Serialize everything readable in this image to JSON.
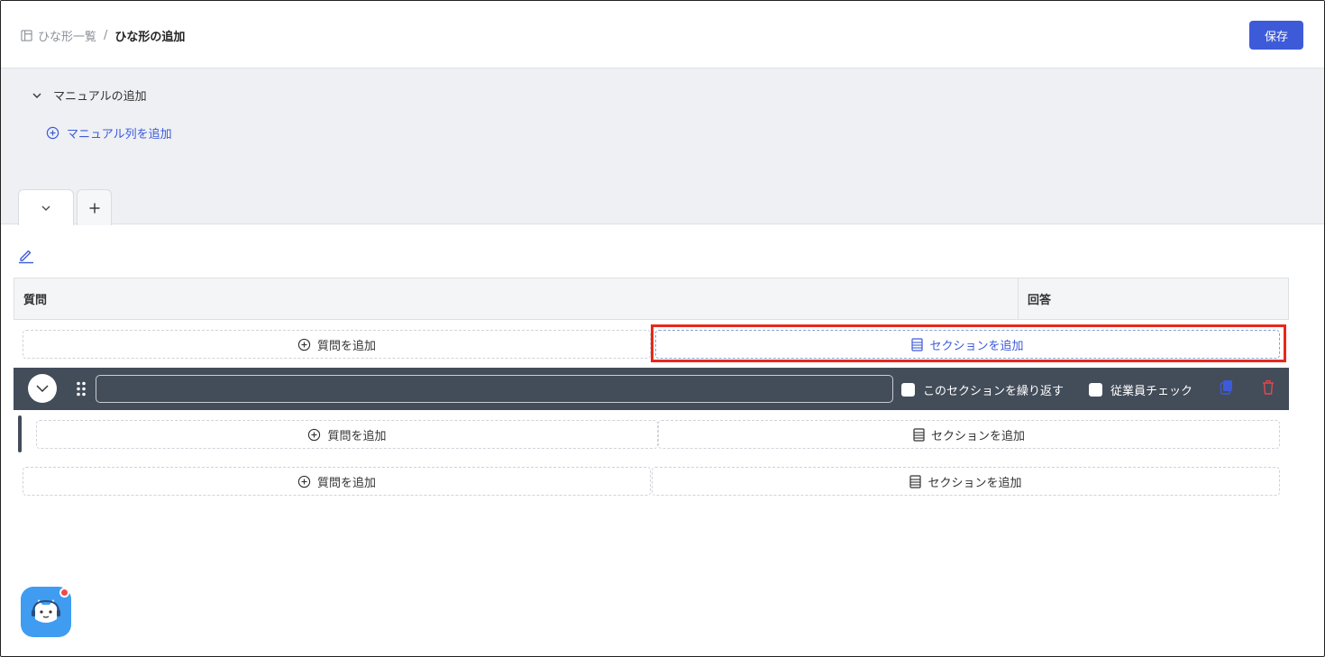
{
  "breadcrumb": {
    "parent": "ひな形一覧",
    "separator": "/",
    "current": "ひな形の追加"
  },
  "header": {
    "save_label": "保存",
    "accent": "#3d5bd9"
  },
  "manual": {
    "title": "マニュアルの追加",
    "add_column_label": "マニュアル列を追加"
  },
  "tabs": [
    {
      "icon": "chevron-down-icon"
    },
    {
      "icon": "plus-icon"
    }
  ],
  "table": {
    "col_question": "質問",
    "col_answer": "回答"
  },
  "actions": {
    "add_question": "質問を追加",
    "add_section": "セクションを追加"
  },
  "section": {
    "name_value": "",
    "repeat_label": "このセクションを繰り返す",
    "employee_check_label": "従業員チェック",
    "bar_color": "#434c59"
  },
  "highlight_color": "#e8281a"
}
